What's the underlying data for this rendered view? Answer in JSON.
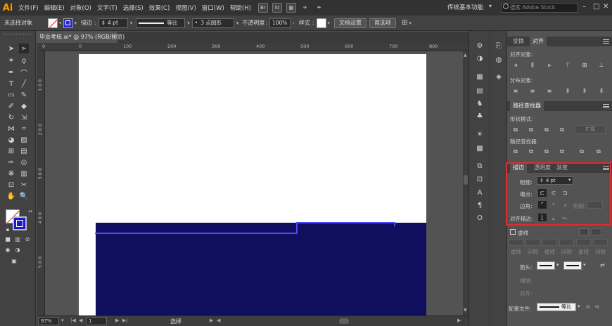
{
  "app": {
    "logo": "Ai"
  },
  "menubar": {
    "items": [
      "文件(F)",
      "编辑(E)",
      "对象(O)",
      "文字(T)",
      "选择(S)",
      "效果(C)",
      "视图(V)",
      "窗口(W)",
      "帮助(H)"
    ],
    "bridge_label": "Br",
    "stock_label": "St",
    "workspace": "传统基本功能",
    "search_placeholder": "搜索 Adobe Stock"
  },
  "controlbar": {
    "selection_state": "未选择对象",
    "stroke_label": "描边",
    "stroke_value": "4 pt",
    "profile_label": "等比",
    "brush_label": "3 点圆形",
    "opacity_label": "不透明度",
    "opacity_value": "100%",
    "style_label": "样式",
    "doc_setup_button": "文档设置",
    "prefs_button": "首选项"
  },
  "document": {
    "tab_title": "毕业考核.ai* @ 97% (RGB/预览)",
    "zoom": "97%",
    "page": "1",
    "status_tool": "选择"
  },
  "rulers": {
    "h": [
      "0",
      "100",
      "200",
      "300",
      "400",
      "500",
      "600",
      "700",
      "800"
    ],
    "v": [
      "1 0 0",
      "2 0 0",
      "3 0 0",
      "4 0 0",
      "5 0 0"
    ]
  },
  "panel_transform_align": {
    "tab_transform": "变换",
    "tab_align": "对齐",
    "align_objects": "对齐对象:",
    "distribute_objects": "分布对象:"
  },
  "panel_pathfinder": {
    "title": "路径查找器",
    "shape_modes": "形状模式:",
    "expand": "扩展",
    "pathfinders": "路径查找器:"
  },
  "panel_stroke": {
    "tab_stroke": "描边",
    "tab_transparency": "透明度",
    "tab_gradient": "渐变",
    "weight_label": "粗细:",
    "weight_value": "4 pt",
    "cap_label": "端点:",
    "corner_label": "边角:",
    "limit_label": "限制:",
    "align_label": "对齐描边:",
    "dashed_label": "虚线",
    "dash_headers": [
      "虚线",
      "间隙",
      "虚线",
      "间隙",
      "虚线",
      "间隙"
    ],
    "arrow_label": "箭头:",
    "scale_label": "缩放:",
    "align_arrow_label": "对齐:",
    "profile_label": "配置文件:",
    "profile_value": "等比"
  },
  "colors": {
    "navy_rect": "#0f0f5e",
    "selection_line": "#4a4aff",
    "highlight_box": "#e12a2a",
    "logo": "#ff9a00"
  }
}
